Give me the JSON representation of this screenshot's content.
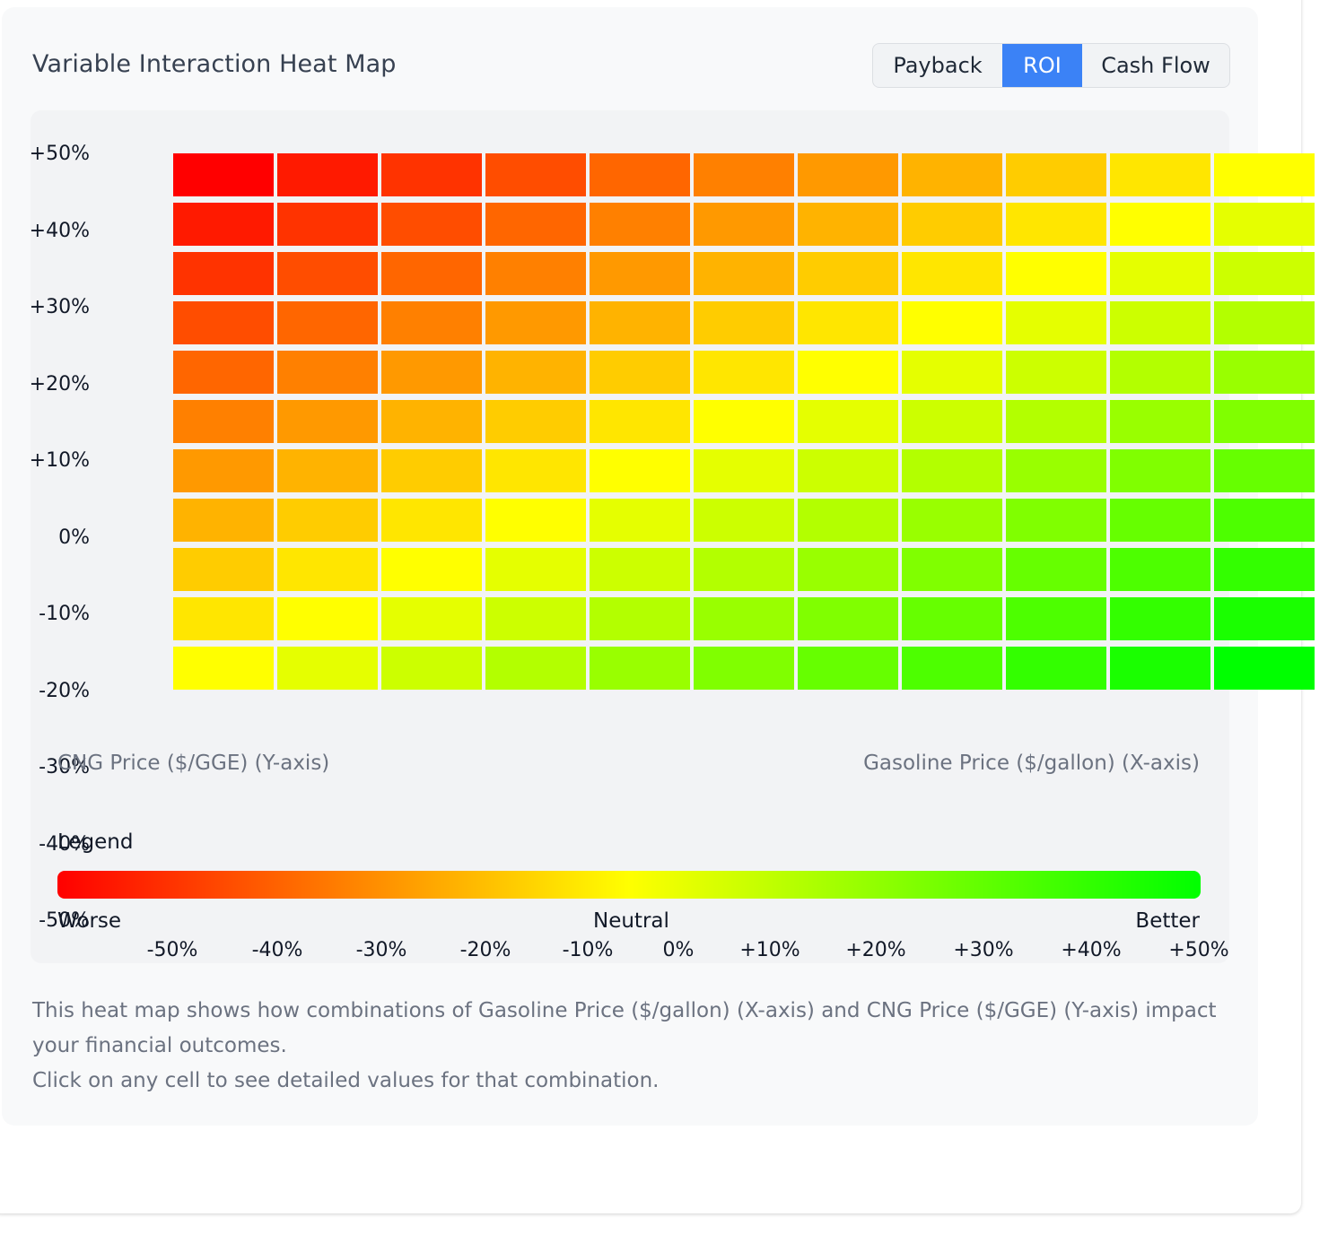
{
  "title": "Variable Interaction Heat Map",
  "toggle": {
    "options": [
      "Payback",
      "ROI",
      "Cash Flow"
    ],
    "active_index": 1
  },
  "axes": {
    "y_name": "CNG Price ($/GGE) (Y-axis)",
    "x_name": "Gasoline Price ($/gallon) (X-axis)"
  },
  "legend": {
    "title": "Legend",
    "worse": "Worse",
    "neutral": "Neutral",
    "better": "Better",
    "colors": {
      "worse": "#ff0000",
      "neutral": "#ffff00",
      "better": "#00ff00"
    }
  },
  "description": {
    "line1": "This heat map shows how combinations of Gasoline Price ($/gallon) (X-axis) and CNG Price ($/GGE) (Y-axis) impact",
    "line2": "your financial outcomes.",
    "line3": "Click on any cell to see detailed values for that combination."
  },
  "chart_data": {
    "type": "heatmap",
    "metric": "ROI",
    "x_ticks": [
      "-50%",
      "-40%",
      "-30%",
      "-20%",
      "-10%",
      "0%",
      "+10%",
      "+20%",
      "+30%",
      "+40%",
      "+50%"
    ],
    "y_ticks": [
      "+50%",
      "+40%",
      "+30%",
      "+20%",
      "+10%",
      "0%",
      "-10%",
      "-20%",
      "-30%",
      "-40%",
      "-50%"
    ],
    "color_scale": [
      "#ff0000",
      "#ffff00",
      "#00ff00"
    ],
    "value_range": [
      0,
      1
    ],
    "values": [
      [
        0.0,
        0.05,
        0.1,
        0.15,
        0.2,
        0.25,
        0.3,
        0.35,
        0.4,
        0.45,
        0.5
      ],
      [
        0.05,
        0.1,
        0.15,
        0.2,
        0.25,
        0.3,
        0.35,
        0.4,
        0.45,
        0.5,
        0.55
      ],
      [
        0.1,
        0.15,
        0.2,
        0.25,
        0.3,
        0.35,
        0.4,
        0.45,
        0.5,
        0.55,
        0.6
      ],
      [
        0.15,
        0.2,
        0.25,
        0.3,
        0.35,
        0.4,
        0.45,
        0.5,
        0.55,
        0.6,
        0.65
      ],
      [
        0.2,
        0.25,
        0.3,
        0.35,
        0.4,
        0.45,
        0.5,
        0.55,
        0.6,
        0.65,
        0.7
      ],
      [
        0.25,
        0.3,
        0.35,
        0.4,
        0.45,
        0.5,
        0.55,
        0.6,
        0.65,
        0.7,
        0.75
      ],
      [
        0.3,
        0.35,
        0.4,
        0.45,
        0.5,
        0.55,
        0.6,
        0.65,
        0.7,
        0.75,
        0.8
      ],
      [
        0.35,
        0.4,
        0.45,
        0.5,
        0.55,
        0.6,
        0.65,
        0.7,
        0.75,
        0.8,
        0.85
      ],
      [
        0.4,
        0.45,
        0.5,
        0.55,
        0.6,
        0.65,
        0.7,
        0.75,
        0.8,
        0.85,
        0.9
      ],
      [
        0.45,
        0.5,
        0.55,
        0.6,
        0.65,
        0.7,
        0.75,
        0.8,
        0.85,
        0.9,
        0.95
      ],
      [
        0.5,
        0.55,
        0.6,
        0.65,
        0.7,
        0.75,
        0.8,
        0.85,
        0.9,
        0.95,
        1.0
      ]
    ]
  }
}
